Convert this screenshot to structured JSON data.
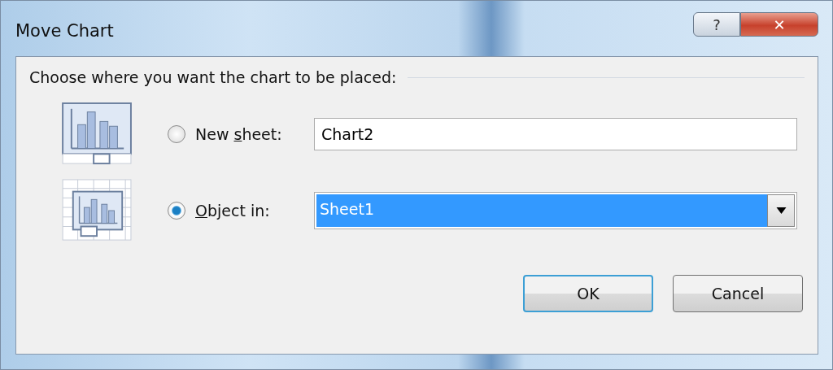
{
  "window": {
    "title": "Move Chart",
    "help_label": "?",
    "close_label": "✕"
  },
  "group": {
    "title": "Choose where you want the chart to be placed:"
  },
  "options": [
    {
      "kind": "new_sheet",
      "label": {
        "before": "New ",
        "key": "s",
        "after": "heet:"
      },
      "selected": false,
      "field": {
        "kind": "text",
        "value": "Chart2"
      }
    },
    {
      "kind": "object_in",
      "label": {
        "key": "O",
        "after": "bject in:"
      },
      "selected": true,
      "field": {
        "kind": "dropdown",
        "value": "Sheet1"
      }
    }
  ],
  "buttons": [
    {
      "label": "OK",
      "default": true
    },
    {
      "label": "Cancel",
      "default": false
    }
  ]
}
